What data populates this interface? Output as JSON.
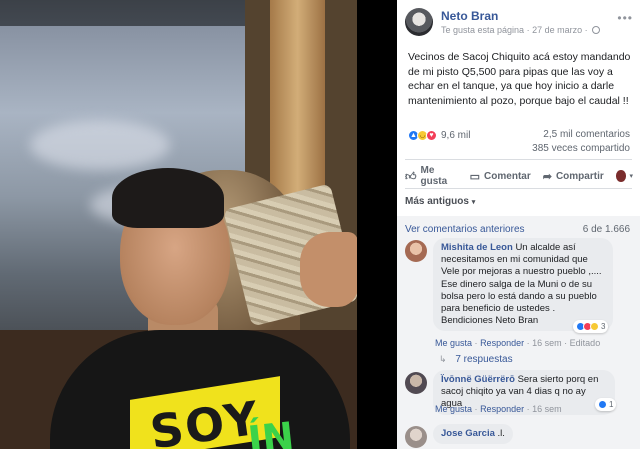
{
  "post": {
    "author": "Neto Bran",
    "meta": {
      "page_like": "Te gusta esta página",
      "separator": "·",
      "date": "27 de marzo",
      "separator2": "·"
    },
    "text": "Vecinos de Sacoj Chiquito acá estoy mandando de mi pisto Q5,500 para pipas que las voy a echar en el tanque, ya que hoy inicio a darle mantenimiento al pozo, porque bajo el caudal !!",
    "reactions_count": "9,6 mil",
    "comments_count": "2,5 mil comentarios",
    "shares_count": "385 veces compartido"
  },
  "photo": {
    "shirt_text_yellow": "SOY",
    "shirt_text_green": "ÍN"
  },
  "actions": {
    "like": "Me gusta",
    "comment": "Comentar",
    "share": "Compartir",
    "caret": "▾"
  },
  "comments_section": {
    "sort_label": "Más antiguos",
    "sort_caret": "▾",
    "previous_label": "Ver comentarios anteriores",
    "pager": "6 de 1.666",
    "comments": [
      {
        "author": "Mishita de Leon",
        "text": "Un alcalde así necesitamos en mi comunidad que Vele por mejoras a nuestro pueblo ,.... Ese dinero salga de la Muni o de su bolsa pero lo está dando a su pueblo para beneficio de ustedes . Bendiciones Neto Bran",
        "like": "Me gusta",
        "reply": "Responder",
        "time": "16 sem",
        "edited": "Editado",
        "reaction_count": "3",
        "sep": "·"
      },
      {
        "author": "Ïvōnnë Güërrërō",
        "text": "Sera sierto porq en sacoj chiqito ya van 4 dias q no ay agua",
        "like": "Me gusta",
        "reply": "Responder",
        "time": "16 sem",
        "reaction_count": "1",
        "sep": "·"
      },
      {
        "author": "Jose Garcia",
        "text": ".l."
      }
    ],
    "replies_label": "7 respuestas"
  },
  "colors": {
    "link": "#385898",
    "like_blue": "#2078f4",
    "love_red": "#f33e58",
    "haha_yellow": "#f7c934"
  }
}
